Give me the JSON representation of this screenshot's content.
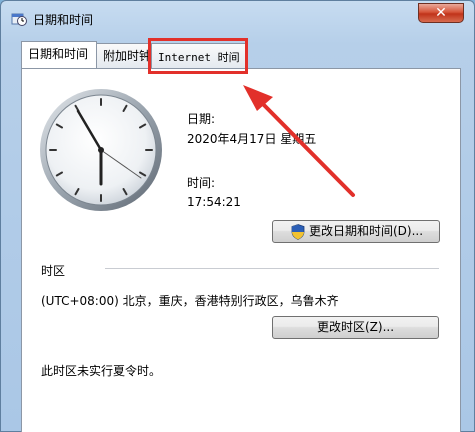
{
  "window": {
    "title": "日期和时间",
    "close_glyph": "✕"
  },
  "tabs": [
    {
      "label": "日期和时间",
      "active": true
    },
    {
      "label": "附加时钟",
      "active": false
    },
    {
      "label": "Internet 时间",
      "active": false
    }
  ],
  "datetime": {
    "date_label": "日期:",
    "date_value": "2020年4月17日 星期五",
    "time_label": "时间:",
    "time_value": "17:54:21",
    "change_button": "更改日期和时间(D)..."
  },
  "timezone": {
    "section_label": "时区",
    "value": "(UTC+08:00) 北京，重庆，香港特别行政区，乌鲁木齐",
    "change_button": "更改时区(Z)...",
    "dst_note": "此时区未实行夏令时。"
  },
  "colors": {
    "highlight": "#e2302a",
    "window_frame": "#b6cfe9"
  },
  "icons": [
    "app-icon",
    "close-icon",
    "shield-icon",
    "clock-icon"
  ]
}
